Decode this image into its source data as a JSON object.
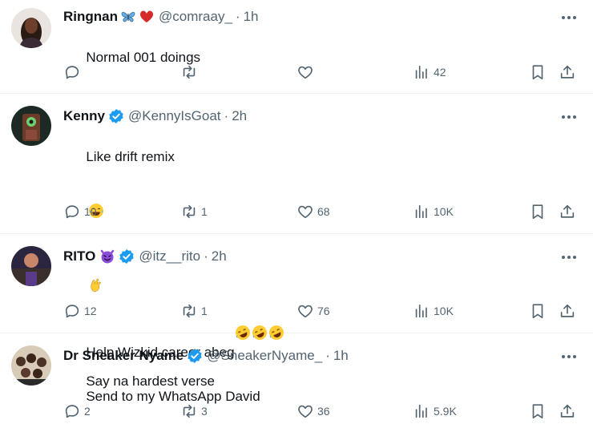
{
  "tweets": [
    {
      "name": "Ringnan",
      "handle": "@comraay_",
      "separator": "·",
      "time": "1h",
      "text": "Normal 001 doings",
      "name_emojis": [
        "butterfly",
        "red-heart"
      ],
      "verified": false,
      "replies": "",
      "retweets": "",
      "likes": "",
      "views": "42"
    },
    {
      "name": "Kenny",
      "handle": "@KennyIsGoat",
      "separator": "·",
      "time": "2h",
      "text": "Like drift remix",
      "text2": "Say na hardest verse",
      "verified": true,
      "replies": "10",
      "retweets": "1",
      "likes": "68",
      "views": "10K"
    },
    {
      "name": "RITO",
      "handle": "@itz__rito",
      "separator": "·",
      "time": "2h",
      "text": "Help Wizkid career abeg",
      "verified": true,
      "replies": "12",
      "retweets": "1",
      "likes": "76",
      "views": "10K"
    },
    {
      "name": "Dr Sneaker Nyame",
      "handle": "@SneakerNyame_",
      "separator": "·",
      "time": "1h",
      "text": "Send to my WhatsApp David",
      "verified": true,
      "replies": "2",
      "retweets": "3",
      "likes": "36",
      "views": "5.9K"
    }
  ],
  "colors": {
    "text": "#0f1419",
    "muted": "#536471",
    "verified": "#1d9bf0",
    "divider": "#eff3f4"
  },
  "icons": [
    "reply-icon",
    "retweet-icon",
    "like-icon",
    "views-icon",
    "bookmark-icon",
    "share-icon",
    "more-icon",
    "verified-badge-icon"
  ]
}
